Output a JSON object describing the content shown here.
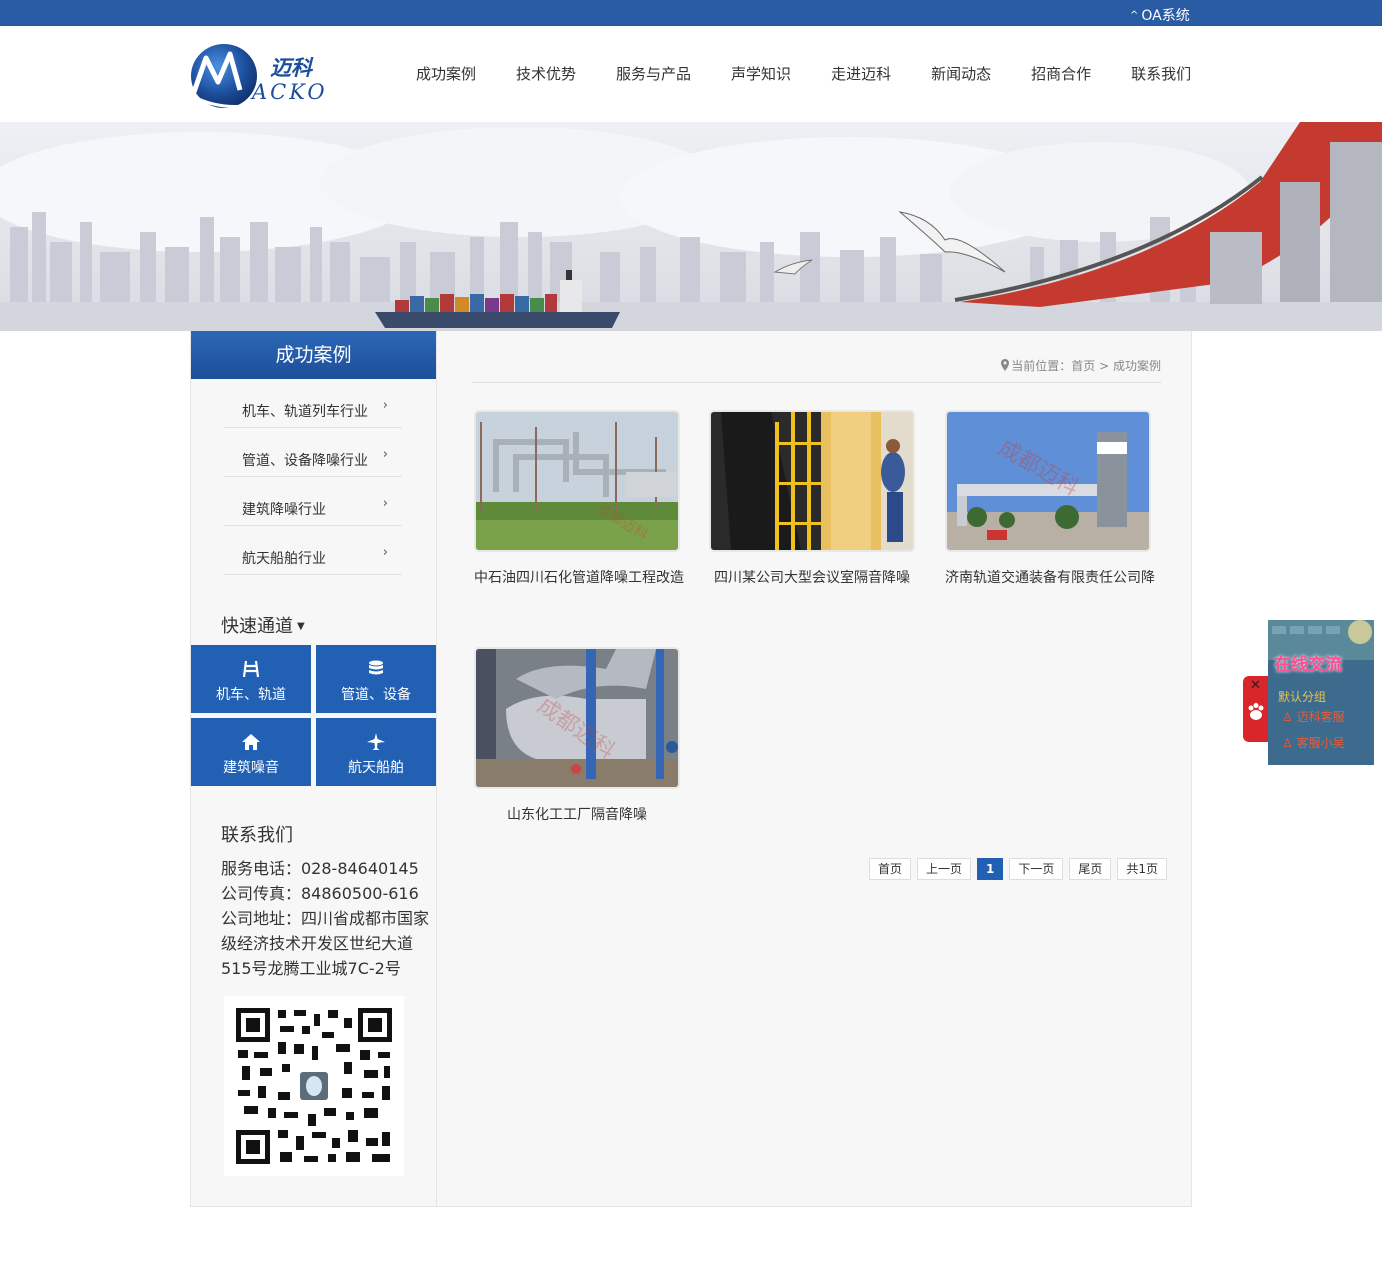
{
  "topbar": {
    "oa_label": "OA系统"
  },
  "header": {
    "logo_cn": "迈科",
    "logo_en": "ACKO",
    "nav": [
      "成功案例",
      "技术优势",
      "服务与产品",
      "声学知识",
      "走进迈科",
      "新闻动态",
      "招商合作",
      "联系我们"
    ]
  },
  "sidebar": {
    "title": "成功案例",
    "categories": [
      "机车、轨道列车行业",
      "管道、设备降噪行业",
      "建筑降噪行业",
      "航天船舶行业"
    ],
    "quick_title": "快速通道",
    "quick_links": [
      {
        "label": "机车、轨道",
        "icon": "railway-icon"
      },
      {
        "label": "管道、设备",
        "icon": "database-icon"
      },
      {
        "label": "建筑噪音",
        "icon": "home-icon"
      },
      {
        "label": "航天船舶",
        "icon": "airplane-icon"
      }
    ],
    "contact_title": "联系我们",
    "contact": {
      "phone": "服务电话：028-84640145",
      "fax": "公司传真：84860500-616",
      "address": "公司地址：四川省成都市国家级经济技术开发区世纪大道515号龙腾工业城7C-2号"
    }
  },
  "main": {
    "breadcrumb": {
      "prefix": "当前位置：",
      "home": "首页",
      "sep": ">",
      "current": "成功案例"
    },
    "cases": [
      {
        "caption": "中石油四川石化管道降噪工程改造",
        "watermark": "成都迈科"
      },
      {
        "caption": "四川某公司大型会议室隔音降噪",
        "watermark": ""
      },
      {
        "caption": "济南轨道交通装备有限责任公司降",
        "watermark": "成都迈科"
      },
      {
        "caption": "山东化工工厂隔音降噪",
        "watermark": "成都迈科"
      }
    ],
    "pager": {
      "first": "首页",
      "prev": "上一页",
      "current": "1",
      "next": "下一页",
      "last": "尾页",
      "total": "共1页"
    }
  },
  "chat": {
    "title": "在线交流",
    "group": "默认分组",
    "people": [
      "迈科客服",
      "客服小吴"
    ]
  },
  "colors": {
    "primary": "#2160b3",
    "topbar": "#2a5ba5",
    "chat_tab": "#d8262a"
  }
}
